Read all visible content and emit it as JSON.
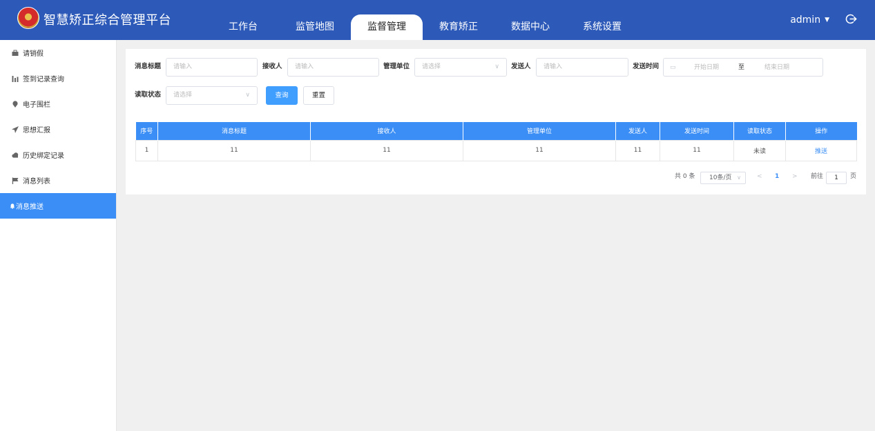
{
  "header": {
    "title": "智慧矫正综合管理平台",
    "user": "admin",
    "nav": [
      {
        "label": "工作台"
      },
      {
        "label": "监管地图"
      },
      {
        "label": "监督管理",
        "active": true
      },
      {
        "label": "教育矫正"
      },
      {
        "label": "数据中心"
      },
      {
        "label": "系统设置"
      }
    ],
    "icons": {
      "logo": "emblem-logo",
      "logout": "logout-icon",
      "dropdown": "caret-down-icon"
    },
    "colors": {
      "header_bg": "#2d5ab9",
      "accent": "#3a8ef5"
    }
  },
  "sidebar": {
    "items": [
      {
        "label": "请销假",
        "icon": "briefcase-icon"
      },
      {
        "label": "签到记录查询",
        "icon": "bar-chart-icon"
      },
      {
        "label": "电子围栏",
        "icon": "location-pin-icon"
      },
      {
        "label": "思想汇报",
        "icon": "send-icon"
      },
      {
        "label": "历史绑定记录",
        "icon": "cloud-icon"
      },
      {
        "label": "消息列表",
        "icon": "flag-icon"
      },
      {
        "label": "消息推送",
        "icon": "bell-icon",
        "active": true
      }
    ]
  },
  "filters": {
    "title_label": "消息标题",
    "title_placeholder": "请输入",
    "receiver_label": "接收人",
    "receiver_placeholder": "请输入",
    "unit_label": "管理单位",
    "unit_placeholder": "请选择",
    "sender_label": "发送人",
    "sender_placeholder": "请输入",
    "time_label": "发送时间",
    "start_placeholder": "开始日期",
    "range_sep": "至",
    "end_placeholder": "结束日期",
    "status_label": "读取状态",
    "status_placeholder": "请选择",
    "search_btn": "查询",
    "reset_btn": "重置"
  },
  "table": {
    "headers": [
      "序号",
      "消息标题",
      "接收人",
      "管理单位",
      "发送人",
      "发送时间",
      "读取状态",
      "操作"
    ],
    "rows": [
      {
        "index": "1",
        "title": "11",
        "receiver": "11",
        "unit": "11",
        "sender": "11",
        "time": "11",
        "status": "未读",
        "action": "推送"
      }
    ]
  },
  "pagination": {
    "total": "共 0 条",
    "page_size": "10条/页",
    "prev": "<",
    "current": "1",
    "next": ">",
    "goto_label": "前往",
    "goto_value": "1",
    "page_unit": "页"
  }
}
